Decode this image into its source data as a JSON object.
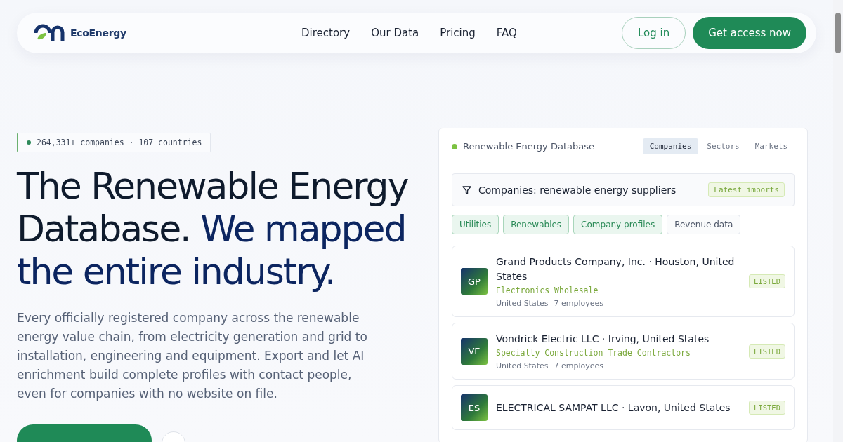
{
  "nav": {
    "logo_text": "EcoEnergy",
    "links": [
      "Directory",
      "Our Data",
      "Pricing",
      "FAQ"
    ],
    "login": "Log in",
    "cta": "Get access now"
  },
  "hero": {
    "badge": "264,331+ companies · 107 countries",
    "title_plain": "The Renewable Energy Database.",
    "title_accent": "We mapped the entire industry.",
    "description": "Every officially registered company across the renewable energy value chain, from electricity generation and grid to installation, engineering and equipment. Export and let AI enrichment build complete profiles with contact people, even for companies with no website on file."
  },
  "panel": {
    "title": "Renewable Energy Database",
    "tabs": [
      {
        "label": "Companies",
        "selected": true
      },
      {
        "label": "Sectors",
        "selected": false
      },
      {
        "label": "Markets",
        "selected": false
      }
    ],
    "query": "Companies: renewable energy suppliers",
    "query_tag": "Latest imports",
    "filters": [
      {
        "label": "Utilities",
        "selected": true
      },
      {
        "label": "Renewables",
        "selected": true
      },
      {
        "label": "Company profiles",
        "selected": true
      },
      {
        "label": "Revenue data",
        "selected": false
      }
    ],
    "companies": [
      {
        "initials": "GP",
        "name": "Grand Products Company, Inc. · Houston, United States",
        "category": "Electronics Wholesale",
        "country": "United States",
        "employees": "7 employees",
        "status": "LISTED"
      },
      {
        "initials": "VE",
        "name": "Vondrick Electric LLC · Irving, United States",
        "category": "Specialty Construction Trade Contractors",
        "country": "United States",
        "employees": "7 employees",
        "status": "LISTED"
      },
      {
        "initials": "ES",
        "name": "ELECTRICAL SAMPAT LLC · Lavon, United States",
        "status": "LISTED"
      }
    ]
  }
}
